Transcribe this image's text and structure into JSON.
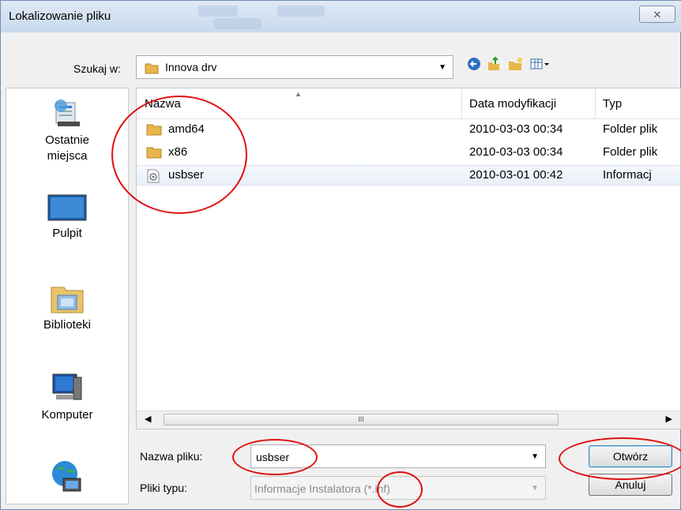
{
  "dialog": {
    "title": "Lokalizowanie pliku",
    "close_glyph": "✕"
  },
  "lookin": {
    "label": "Szukaj w:",
    "value": "Innova drv"
  },
  "toolbar": {
    "icons": [
      "back-icon",
      "up-folder-icon",
      "new-folder-icon",
      "view-menu-icon"
    ]
  },
  "places": [
    {
      "label_1": "Ostatnie",
      "label_2": "miejsca",
      "icon": "recent-places-icon"
    },
    {
      "label_1": "Pulpit",
      "icon": "desktop-icon"
    },
    {
      "label_1": "Biblioteki",
      "icon": "libraries-icon"
    },
    {
      "label_1": "Komputer",
      "icon": "computer-icon"
    },
    {
      "icon": "network-icon"
    }
  ],
  "columns": {
    "name": "Nazwa",
    "date": "Data modyfikacji",
    "type": "Typ"
  },
  "files": [
    {
      "name": "amd64",
      "date": "2010-03-03 00:34",
      "type": "Folder plik",
      "icon": "folder-icon"
    },
    {
      "name": "x86",
      "date": "2010-03-03 00:34",
      "type": "Folder plik",
      "icon": "folder-icon"
    },
    {
      "name": "usbser",
      "date": "2010-03-01 00:42",
      "type": "Informacj",
      "icon": "inf-file-icon"
    }
  ],
  "scrollbar": {
    "thumb_grip": "III"
  },
  "form": {
    "filename_label": "Nazwa pliku:",
    "filename_value": "usbser",
    "filetype_label": "Pliki typu:",
    "filetype_value": "Informacje Instalatora (*.inf)"
  },
  "buttons": {
    "open": "Otwórz",
    "cancel": "Anuluj"
  },
  "colors": {
    "annotation": "#e01010",
    "folder": "#e8b64a"
  }
}
